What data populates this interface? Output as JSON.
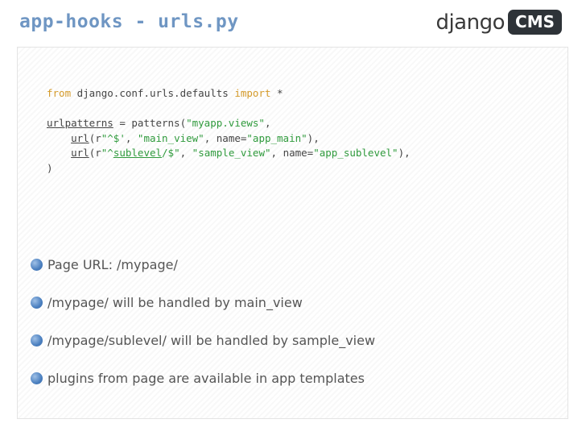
{
  "header": {
    "title": "app-hooks - urls.py",
    "logo": {
      "word": "django",
      "badge": "CMS"
    }
  },
  "code": {
    "line1": {
      "kw_from": "from",
      "module": " django.conf.urls.defaults ",
      "kw_import": "import",
      "rest": " *"
    },
    "line2": {
      "name": "urlpatterns",
      "pre": " = patterns(",
      "arg": "\"myapp.views\"",
      "post": ","
    },
    "line3": {
      "indent": "    ",
      "fn": "url",
      "p1": "(r",
      "pattern": "\"^$'",
      "sep1": ", ",
      "view": "\"main_view\"",
      "sep2": ", name=",
      "name": "\"app_main\"",
      "end": "),"
    },
    "line4": {
      "indent": "    ",
      "fn": "url",
      "p1": "(r",
      "pattern_pre": "\"^",
      "pattern_ul": "sublevel",
      "pattern_post": "/$\"",
      "sep1": ", ",
      "view": "\"sample_view\"",
      "sep2": ", name=",
      "name": "\"app_sublevel\"",
      "end": "),"
    },
    "line5": ")"
  },
  "bullets": [
    "Page URL: /mypage/",
    "/mypage/ will be handled by main_view",
    "/mypage/sublevel/ will be handled by sample_view",
    "plugins from page are available in app templates"
  ],
  "colors": {
    "title": "#6f96c3",
    "keyword": "#d49a2a",
    "string": "#2f9a3c",
    "bullet": "#4a7fbf"
  }
}
